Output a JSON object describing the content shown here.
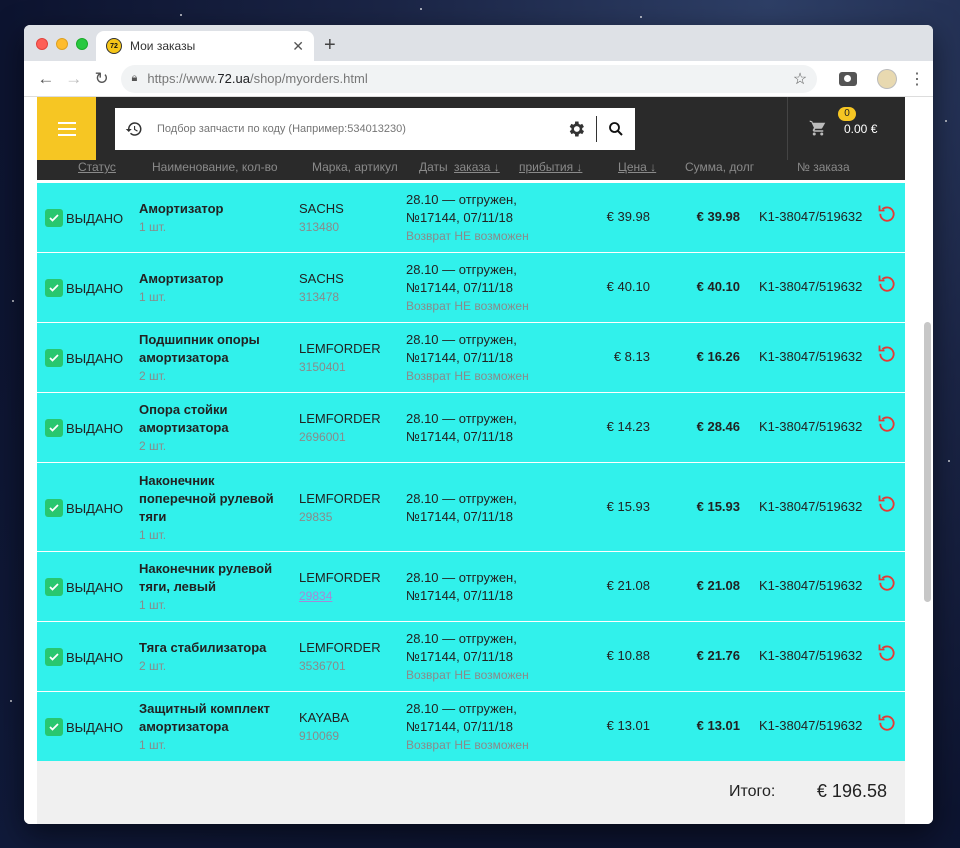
{
  "browser": {
    "tab_title": "Мои заказы",
    "favicon_text": "72",
    "url_host_prefix": "https://www.",
    "url_host": "72.ua",
    "url_path": "/shop/myorders.html"
  },
  "header": {
    "search_placeholder": "Подбор запчасти по коду (Например:534013230)",
    "cart_count": "0",
    "cart_total": "0.00 €",
    "accent_color": "#f6c623"
  },
  "columns": {
    "status": "Статус",
    "name": "Наименование, кол-во",
    "brand": "Марка, артикул",
    "dates": "Даты",
    "order_sort": "заказа ↓",
    "arrival_sort": "прибытия ↓",
    "price": "Цена ↓",
    "sum": "Сумма, долг",
    "order_no": "№ заказа"
  },
  "orders": [
    {
      "status": "ВЫДАНО",
      "name": "Амортизатор",
      "qty": "1 шт.",
      "brand": "SACHS",
      "article": "313480",
      "date1": "28.10 — отгружен,",
      "date2": "№17144, 07/11/18",
      "note": "Возврат НЕ возможен",
      "price": "€ 39.98",
      "sum": "€ 39.98",
      "order_no": "K1-38047/519632"
    },
    {
      "status": "ВЫДАНО",
      "name": "Амортизатор",
      "qty": "1 шт.",
      "brand": "SACHS",
      "article": "313478",
      "date1": "28.10 — отгружен,",
      "date2": "№17144, 07/11/18",
      "note": "Возврат НЕ возможен",
      "price": "€ 40.10",
      "sum": "€ 40.10",
      "order_no": "K1-38047/519632"
    },
    {
      "status": "ВЫДАНО",
      "name": "Подшипник опоры амортизатора",
      "qty": "2 шт.",
      "brand": "LEMFORDER",
      "article": "3150401",
      "date1": "28.10 — отгружен,",
      "date2": "№17144, 07/11/18",
      "note": "Возврат НЕ возможен",
      "price": "€ 8.13",
      "sum": "€ 16.26",
      "order_no": "K1-38047/519632"
    },
    {
      "status": "ВЫДАНО",
      "name": "Опора стойки амортизатора",
      "qty": "2 шт.",
      "brand": "LEMFORDER",
      "article": "2696001",
      "date1": "28.10 — отгружен,",
      "date2": "№17144, 07/11/18",
      "note": "",
      "price": "€ 14.23",
      "sum": "€ 28.46",
      "order_no": "K1-38047/519632"
    },
    {
      "status": "ВЫДАНО",
      "name": "Наконечник поперечной рулевой тяги",
      "qty": "1 шт.",
      "brand": "LEMFORDER",
      "article": "29835",
      "date1": "28.10 — отгружен,",
      "date2": "№17144, 07/11/18",
      "note": "",
      "price": "€ 15.93",
      "sum": "€ 15.93",
      "order_no": "K1-38047/519632"
    },
    {
      "status": "ВЫДАНО",
      "name": "Наконечник рулевой тяги, левый",
      "qty": "1 шт.",
      "brand": "LEMFORDER",
      "article": "29834",
      "date1": "28.10 — отгружен,",
      "date2": "№17144, 07/11/18",
      "note": "",
      "price": "€ 21.08",
      "sum": "€ 21.08",
      "order_no": "K1-38047/519632"
    },
    {
      "status": "ВЫДАНО",
      "name": "Тяга стабилизатора",
      "qty": "2 шт.",
      "brand": "LEMFORDER",
      "article": "3536701",
      "date1": "28.10 — отгружен,",
      "date2": "№17144, 07/11/18",
      "note": "Возврат НЕ возможен",
      "price": "€ 10.88",
      "sum": "€ 21.76",
      "order_no": "K1-38047/519632"
    },
    {
      "status": "ВЫДАНО",
      "name": "Защитный комплект амортизатора",
      "qty": "1 шт.",
      "brand": "KAYABA",
      "article": "910069",
      "date1": "28.10 — отгружен,",
      "date2": "№17144, 07/11/18",
      "note": "Возврат НЕ возможен",
      "price": "€ 13.01",
      "sum": "€ 13.01",
      "order_no": "K1-38047/519632"
    }
  ],
  "total": {
    "label": "Итого:",
    "value": "€ 196.58"
  },
  "colors": {
    "row_bg": "#31f1eb",
    "status_check": "#28c76f",
    "return_icon": "#e53935"
  }
}
